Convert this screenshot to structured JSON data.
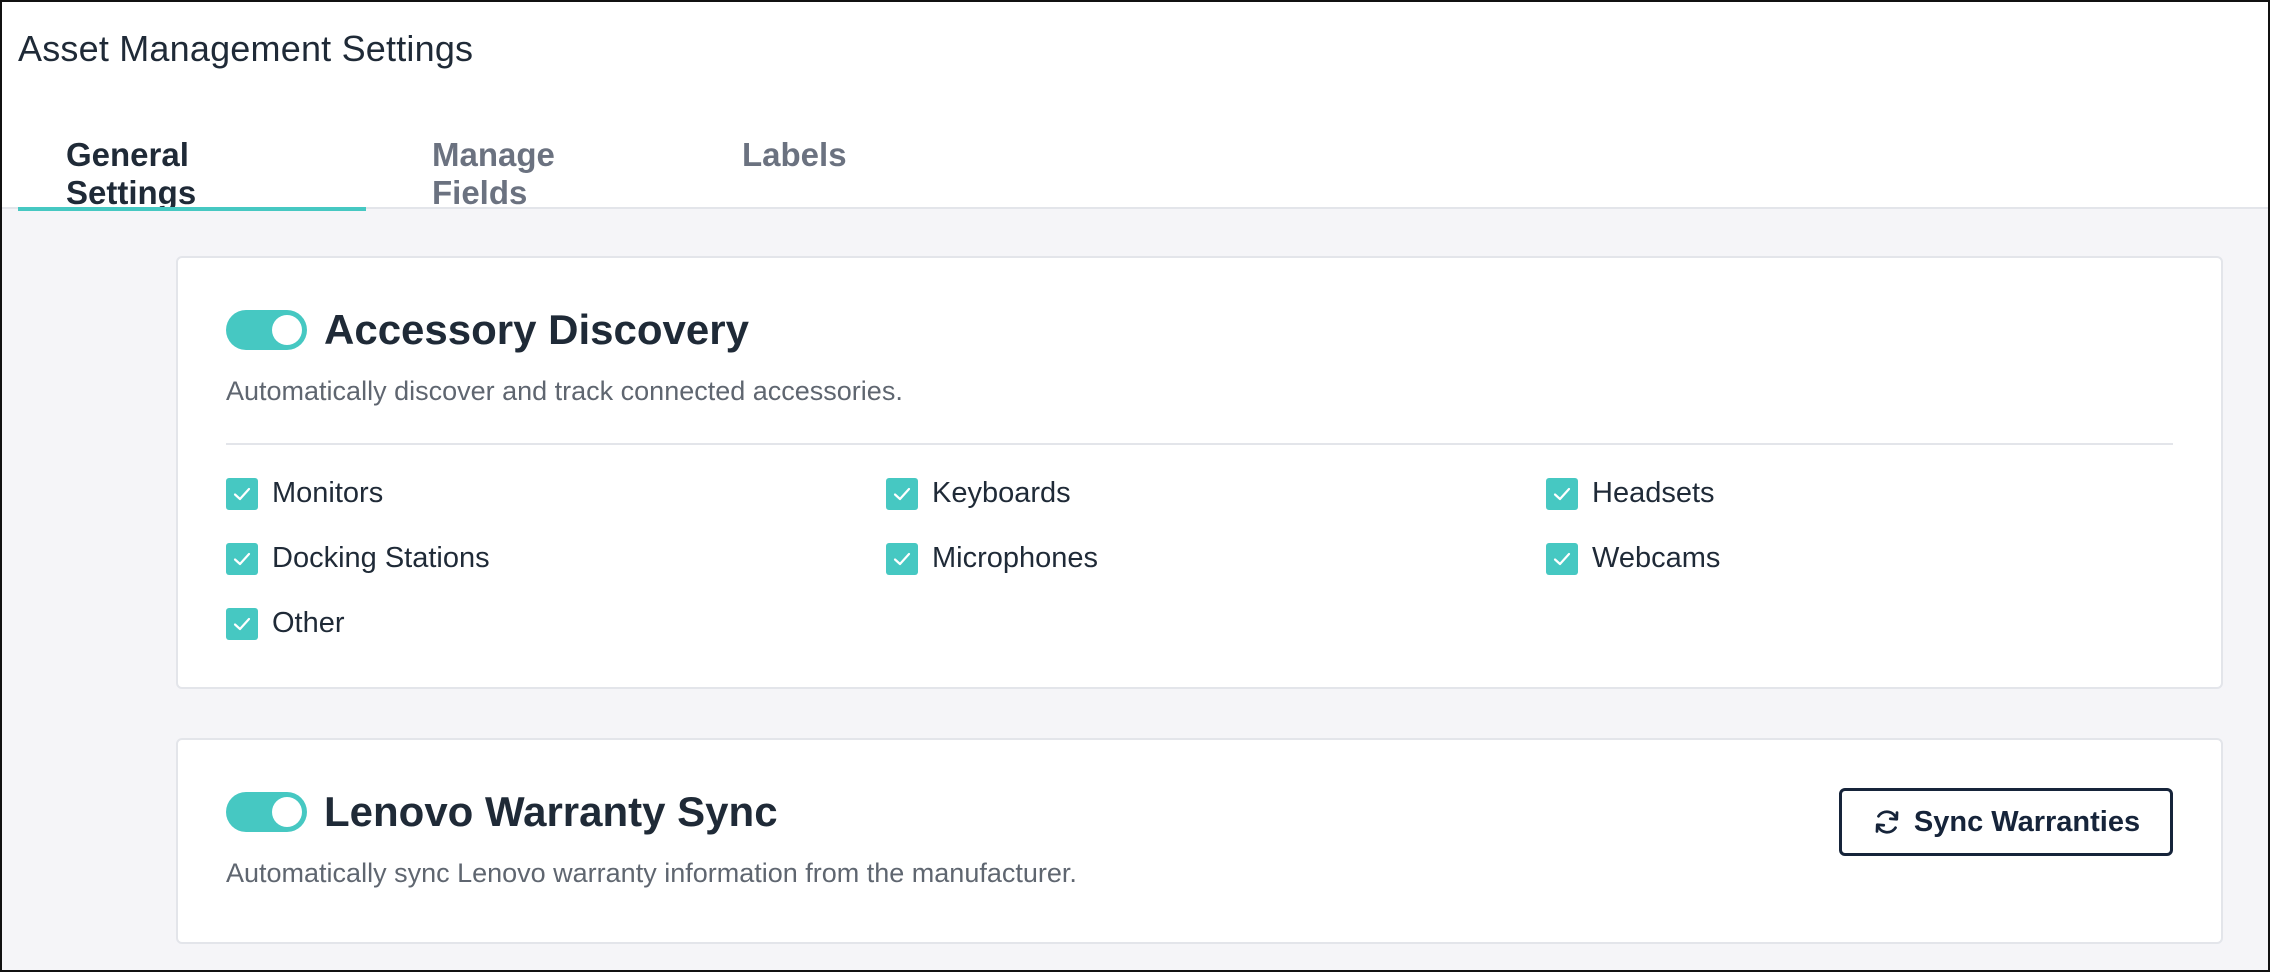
{
  "header": {
    "title": "Asset Management Settings"
  },
  "tabs": [
    {
      "label": "General Settings",
      "active": true
    },
    {
      "label": "Manage Fields",
      "active": false
    },
    {
      "label": "Labels",
      "active": false
    }
  ],
  "accessory_discovery": {
    "enabled": true,
    "title": "Accessory Discovery",
    "description": "Automatically discover and track connected accessories.",
    "options": [
      {
        "label": "Monitors",
        "checked": true
      },
      {
        "label": "Keyboards",
        "checked": true
      },
      {
        "label": "Headsets",
        "checked": true
      },
      {
        "label": "Docking Stations",
        "checked": true
      },
      {
        "label": "Microphones",
        "checked": true
      },
      {
        "label": "Webcams",
        "checked": true
      },
      {
        "label": "Other",
        "checked": true
      }
    ]
  },
  "warranty_sync": {
    "enabled": true,
    "title": "Lenovo Warranty Sync",
    "description": "Automatically sync Lenovo warranty information from the manufacturer.",
    "button_label": "Sync Warranties",
    "button_icon": "refresh-icon"
  },
  "colors": {
    "accent": "#46c8c2",
    "text_primary": "#1f2a37",
    "text_secondary": "#5f6670",
    "background": "#f5f5f8"
  }
}
